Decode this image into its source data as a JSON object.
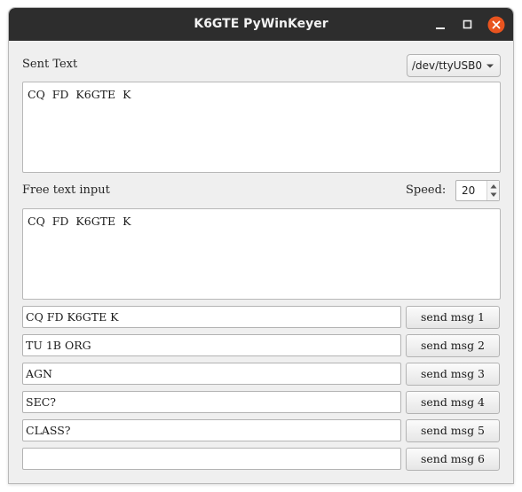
{
  "window": {
    "title": "K6GTE PyWinKeyer"
  },
  "sent": {
    "label": "Sent Text",
    "text": "CQ  FD  K6GTE  K"
  },
  "port": {
    "selected": "/dev/ttyUSB0"
  },
  "free": {
    "label": "Free  text  input",
    "text": "CQ  FD  K6GTE  K"
  },
  "speed": {
    "label": "Speed:",
    "value": "20"
  },
  "messages": [
    {
      "value": "CQ  FD  K6GTE  K",
      "button": "send  msg  1"
    },
    {
      "value": "TU  1B  ORG",
      "button": "send  msg  2"
    },
    {
      "value": "AGN",
      "button": "send  msg  3"
    },
    {
      "value": "SEC?",
      "button": "send  msg  4"
    },
    {
      "value": "CLASS?",
      "button": "send  msg  5"
    },
    {
      "value": "",
      "button": "send  msg  6"
    }
  ],
  "colors": {
    "titlebar": "#2d2d2d",
    "close_button": "#e9541f",
    "window_bg": "#efefef"
  },
  "icons": [
    "minimize-icon",
    "maximize-icon",
    "close-icon",
    "dropdown-arrow-icon",
    "spin-up-icon",
    "spin-down-icon"
  ]
}
